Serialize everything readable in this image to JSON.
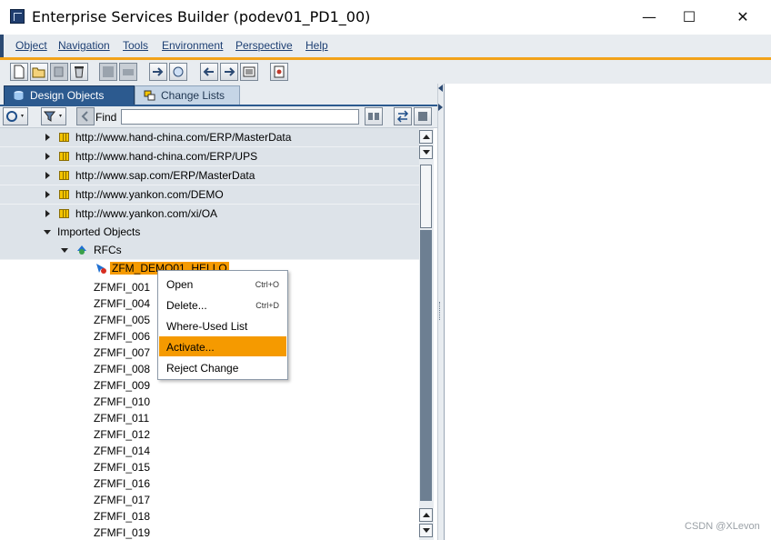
{
  "window": {
    "title": "Enterprise Services Builder (podev01_PD1_00)",
    "minimize_glyph": "—",
    "maximize_glyph": "☐",
    "close_glyph": "✕"
  },
  "menubar": {
    "items": [
      "Object",
      "Navigation",
      "Tools",
      "Environment",
      "Perspective",
      "Help"
    ]
  },
  "toolbar": {
    "icons": [
      "new-icon",
      "open-icon",
      "copy-icon",
      "delete-icon",
      "check-icon",
      "print-icon",
      "navigate-icon",
      "display-icon",
      "back-icon",
      "forward-icon",
      "list-icon",
      "settings-icon"
    ]
  },
  "tabs": {
    "design_objects": "Design Objects",
    "change_lists": "Change Lists"
  },
  "findbar": {
    "label": "Find",
    "value": ""
  },
  "tree": {
    "namespaces": [
      "http://www.hand-china.com/ERP/MasterData",
      "http://www.hand-china.com/ERP/UPS",
      "http://www.sap.com/ERP/MasterData",
      "http://www.yankon.com/DEMO",
      "http://www.yankon.com/xi/OA"
    ],
    "imported_objects": "Imported Objects",
    "rfcs": "RFCs",
    "selected_item": "ZFM_DEMO01_HELLO",
    "items": [
      "ZFMFI_001",
      "ZFMFI_004",
      "ZFMFI_005",
      "ZFMFI_006",
      "ZFMFI_007",
      "ZFMFI_008",
      "ZFMFI_009",
      "ZFMFI_010",
      "ZFMFI_011",
      "ZFMFI_012",
      "ZFMFI_014",
      "ZFMFI_015",
      "ZFMFI_016",
      "ZFMFI_017",
      "ZFMFI_018",
      "ZFMFI_019"
    ]
  },
  "context_menu": {
    "items": [
      {
        "label": "Open",
        "shortcut": "Ctrl+O"
      },
      {
        "label": "Delete...",
        "shortcut": "Ctrl+D"
      },
      {
        "label": "Where-Used List",
        "shortcut": ""
      },
      {
        "label": "Activate...",
        "shortcut": ""
      },
      {
        "label": "Reject Change",
        "shortcut": ""
      }
    ],
    "highlighted": "Activate..."
  },
  "watermark": "CSDN @XLevon",
  "colors": {
    "accent_orange": "#f59a00",
    "tab_active": "#2c5a8f",
    "menu_text": "#1d3f73"
  }
}
